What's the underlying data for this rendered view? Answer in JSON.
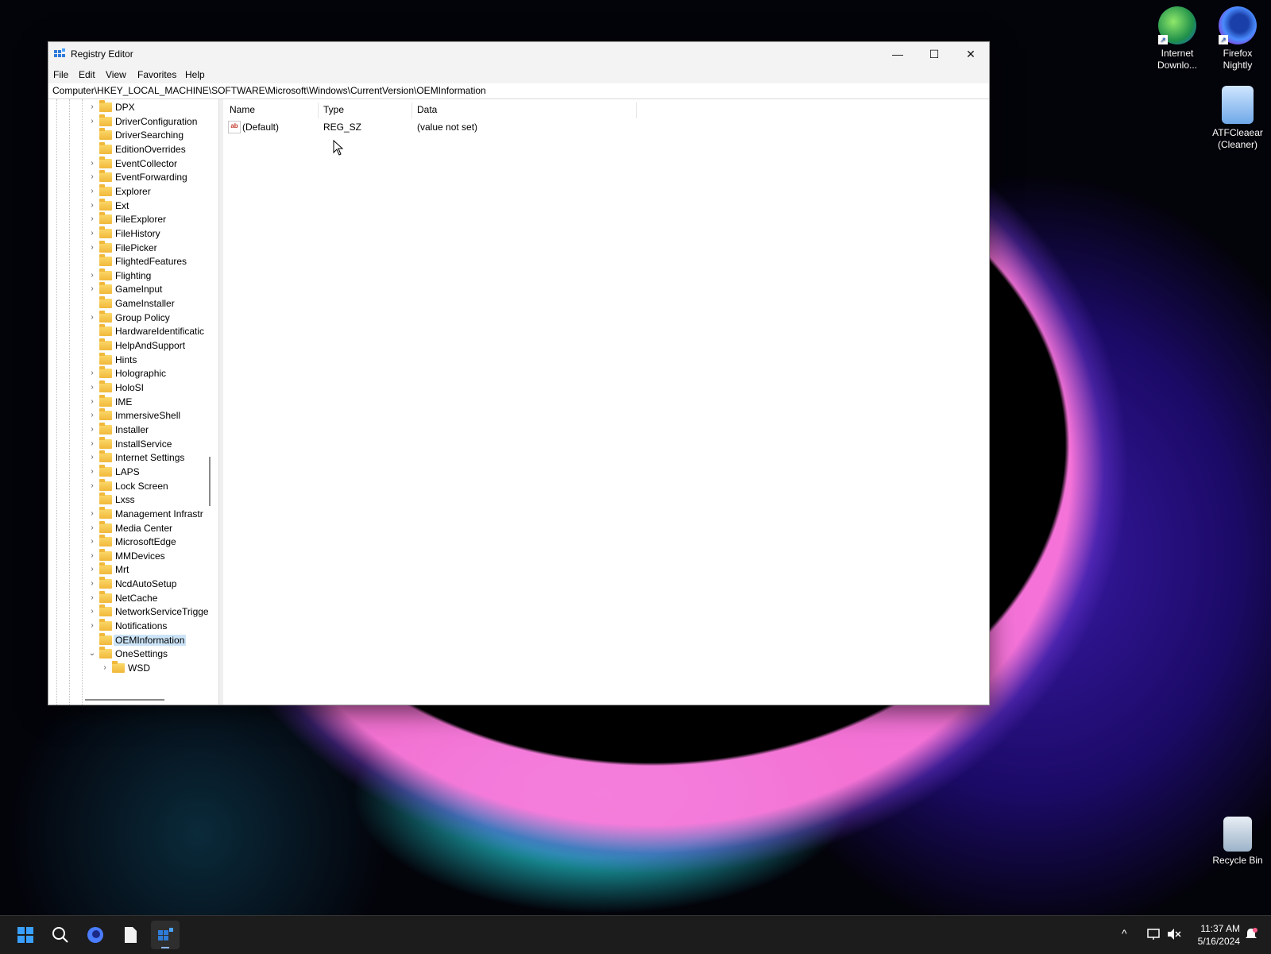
{
  "desktop": {
    "icons": [
      {
        "label_line1": "Internet",
        "label_line2": "Downlo..."
      },
      {
        "label_line1": "Firefox",
        "label_line2": "Nightly"
      },
      {
        "label_line1": "ATFCleaear",
        "label_line2": "(Cleaner)"
      },
      {
        "label_line1": "Recycle Bin",
        "label_line2": ""
      }
    ]
  },
  "window": {
    "title": "Registry Editor",
    "minimize_glyph": "—",
    "maximize_glyph": "☐",
    "close_glyph": "✕",
    "menu": [
      "File",
      "Edit",
      "View",
      "Favorites",
      "Help"
    ],
    "address": "Computer\\HKEY_LOCAL_MACHINE\\SOFTWARE\\Microsoft\\Windows\\CurrentVersion\\OEMInformation"
  },
  "tree": {
    "items": [
      {
        "label": "DPX",
        "expandable": true
      },
      {
        "label": "DriverConfiguration",
        "expandable": true
      },
      {
        "label": "DriverSearching",
        "expandable": false
      },
      {
        "label": "EditionOverrides",
        "expandable": false
      },
      {
        "label": "EventCollector",
        "expandable": true
      },
      {
        "label": "EventForwarding",
        "expandable": true
      },
      {
        "label": "Explorer",
        "expandable": true
      },
      {
        "label": "Ext",
        "expandable": true
      },
      {
        "label": "FileExplorer",
        "expandable": true
      },
      {
        "label": "FileHistory",
        "expandable": true
      },
      {
        "label": "FilePicker",
        "expandable": true
      },
      {
        "label": "FlightedFeatures",
        "expandable": false
      },
      {
        "label": "Flighting",
        "expandable": true
      },
      {
        "label": "GameInput",
        "expandable": true
      },
      {
        "label": "GameInstaller",
        "expandable": false
      },
      {
        "label": "Group Policy",
        "expandable": true
      },
      {
        "label": "HardwareIdentificatic",
        "expandable": false
      },
      {
        "label": "HelpAndSupport",
        "expandable": false
      },
      {
        "label": "Hints",
        "expandable": false
      },
      {
        "label": "Holographic",
        "expandable": true
      },
      {
        "label": "HoloSI",
        "expandable": true
      },
      {
        "label": "IME",
        "expandable": true
      },
      {
        "label": "ImmersiveShell",
        "expandable": true
      },
      {
        "label": "Installer",
        "expandable": true
      },
      {
        "label": "InstallService",
        "expandable": true
      },
      {
        "label": "Internet Settings",
        "expandable": true
      },
      {
        "label": "LAPS",
        "expandable": true
      },
      {
        "label": "Lock Screen",
        "expandable": true
      },
      {
        "label": "Lxss",
        "expandable": false
      },
      {
        "label": "Management Infrastr",
        "expandable": true
      },
      {
        "label": "Media Center",
        "expandable": true
      },
      {
        "label": "MicrosoftEdge",
        "expandable": true
      },
      {
        "label": "MMDevices",
        "expandable": true
      },
      {
        "label": "Mrt",
        "expandable": true
      },
      {
        "label": "NcdAutoSetup",
        "expandable": true
      },
      {
        "label": "NetCache",
        "expandable": true
      },
      {
        "label": "NetworkServiceTrigge",
        "expandable": true
      },
      {
        "label": "Notifications",
        "expandable": true
      },
      {
        "label": "OEMInformation",
        "expandable": false,
        "selected": true
      },
      {
        "label": "OneSettings",
        "expandable": true,
        "expanded": true
      },
      {
        "label": "WSD",
        "expandable": true,
        "child": true
      }
    ]
  },
  "list": {
    "columns": [
      "Name",
      "Type",
      "Data"
    ],
    "rows": [
      {
        "icon": "ab",
        "name": "(Default)",
        "type": "REG_SZ",
        "data": "(value not set)"
      }
    ]
  },
  "taskbar": {
    "time": "11:37 AM",
    "date": "5/16/2024",
    "icons": [
      "start-icon",
      "search-icon",
      "firefox-icon",
      "file-icon",
      "regedit-icon"
    ],
    "tray": [
      "chevron-up-icon",
      "network-icon",
      "volume-muted-icon",
      "notification-bell-icon"
    ]
  }
}
